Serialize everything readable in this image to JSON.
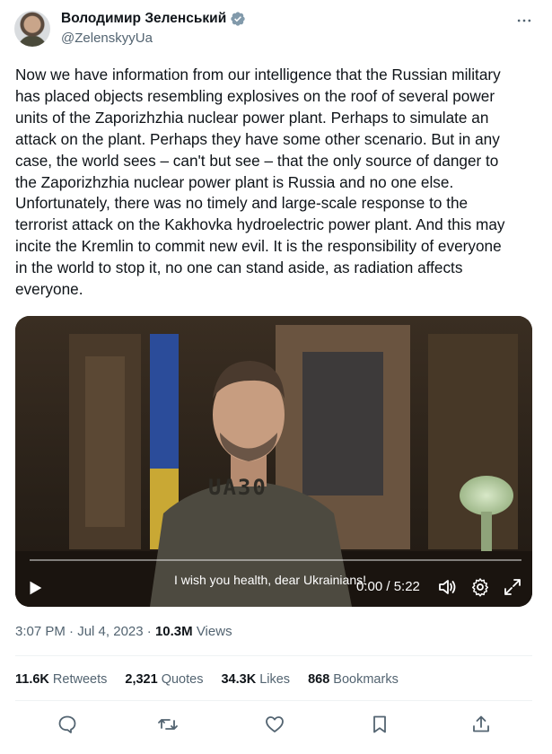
{
  "author": {
    "name": "Володимир Зеленський",
    "handle": "@ZelenskyyUa",
    "verified_icon": "verified-badge-icon"
  },
  "tweet": {
    "text": "Now we have information from our intelligence that the Russian military\nhas placed objects resembling explosives on the roof of several power\nunits of the Zaporizhzhia nuclear power plant. Perhaps to simulate an\nattack on the plant. Perhaps they have some other scenario. But in any\ncase, the world sees – can't but see – that the only source of danger to\nthe Zaporizhzhia nuclear power plant is Russia and no one else.\nUnfortunately, there was no timely and large-scale response to the\nterrorist attack on the Kakhovka hydroelectric power plant. And this may\nincite the Kremlin to commit new evil. It is the responsibility of everyone\nin the world to stop it, no one can stand aside, as radiation affects\neveryone."
  },
  "video": {
    "caption": "I wish you health, dear Ukrainians!",
    "time": "0:00 / 5:22",
    "shirt_text": "UA30",
    "progress": 0
  },
  "meta": {
    "time": "3:07 PM",
    "separator1": " · ",
    "date": "Jul 4, 2023",
    "separator2": " · ",
    "views_count": "10.3M",
    "views_label": " Views"
  },
  "stats": {
    "retweets_count": "11.6K",
    "retweets_label": " Retweets",
    "quotes_count": "2,321",
    "quotes_label": " Quotes",
    "likes_count": "34.3K",
    "likes_label": " Likes",
    "bookmarks_count": "868",
    "bookmarks_label": " Bookmarks"
  },
  "colors": {
    "text": "#0f1419",
    "muted": "#536471",
    "verified": "#829aab",
    "divider": "#eff3f4"
  },
  "icons": [
    "more-icon",
    "play-icon",
    "volume-icon",
    "settings-icon",
    "fullscreen-icon",
    "reply-icon",
    "retweet-icon",
    "like-icon",
    "bookmark-icon",
    "share-icon"
  ]
}
